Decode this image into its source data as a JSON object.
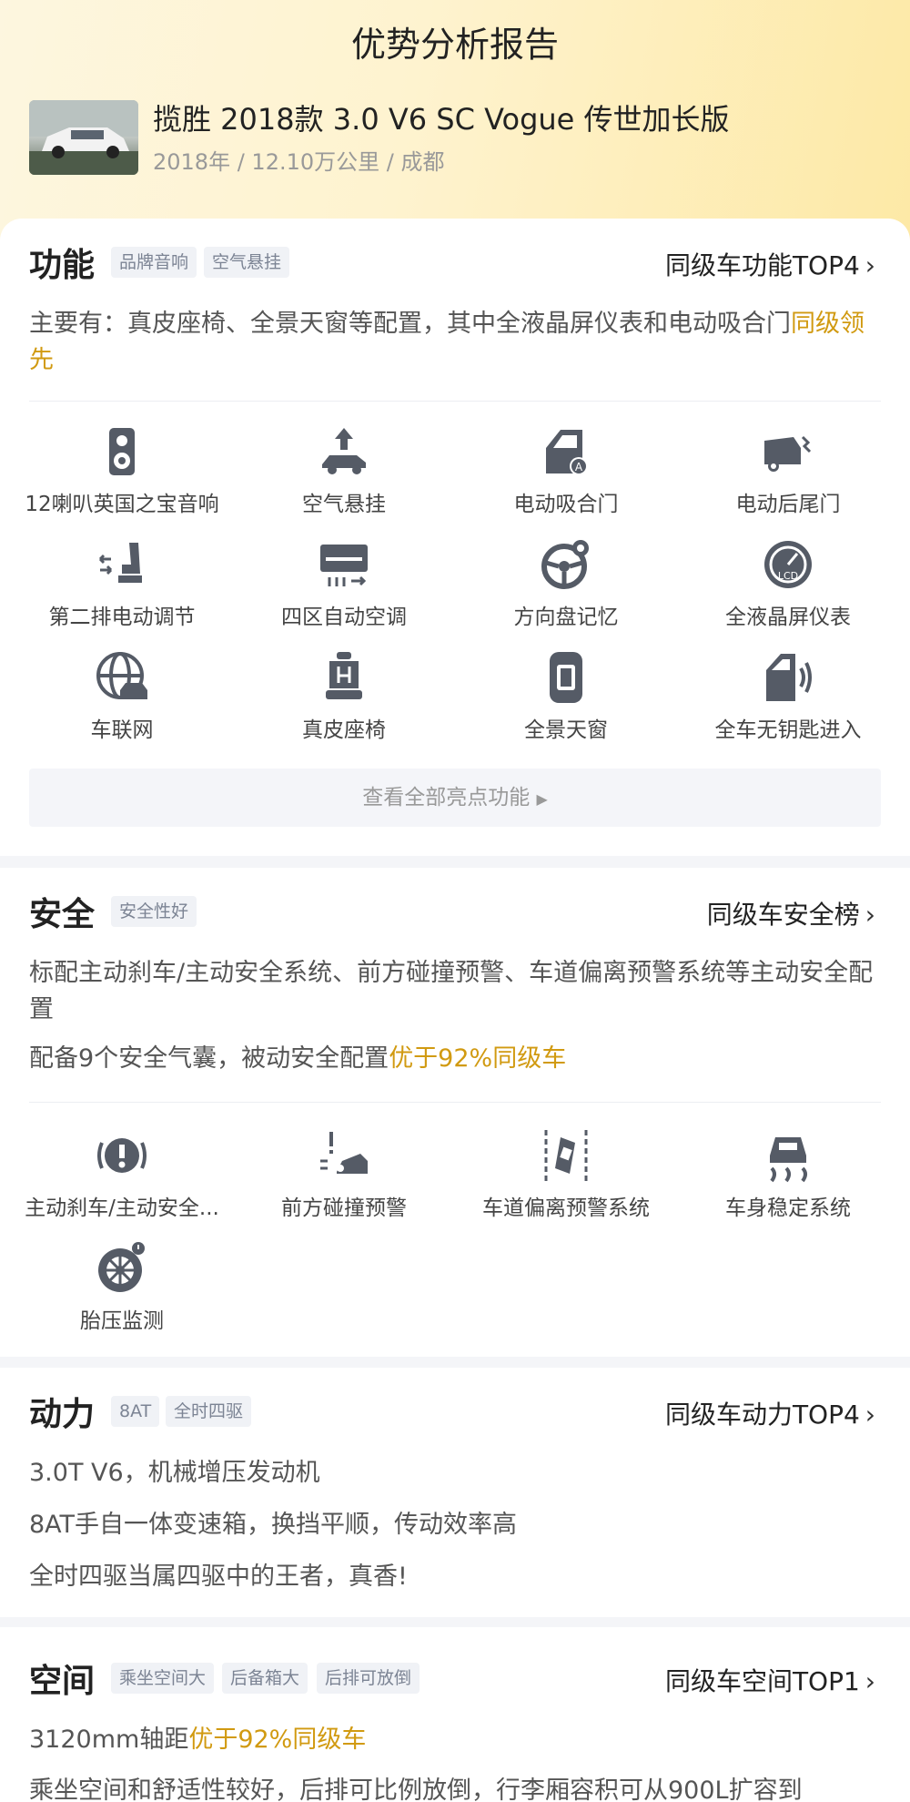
{
  "header": {
    "title": "优势分析报告",
    "car_name": "揽胜 2018款 3.0 V6 SC Vogue 传世加长版",
    "car_meta": "2018年 / 12.10万公里 / 成都"
  },
  "function": {
    "title": "功能",
    "tags": [
      "品牌音响",
      "空气悬挂"
    ],
    "rank_label": "同级车功能TOP4",
    "desc_main": "主要有：真皮座椅、全景天窗等配置，其中全液晶屏仪表和电动吸合门",
    "desc_hl": "同级领先",
    "features": [
      {
        "label": "12喇叭英国之宝音响",
        "icon": "speaker-icon"
      },
      {
        "label": "空气悬挂",
        "icon": "air-suspension-icon"
      },
      {
        "label": "电动吸合门",
        "icon": "soft-close-door-icon"
      },
      {
        "label": "电动后尾门",
        "icon": "power-tailgate-icon"
      },
      {
        "label": "第二排电动调节",
        "icon": "second-row-seat-icon"
      },
      {
        "label": "四区自动空调",
        "icon": "climate-control-icon"
      },
      {
        "label": "方向盘记忆",
        "icon": "steering-memory-icon"
      },
      {
        "label": "全液晶屏仪表",
        "icon": "lcd-gauge-icon"
      },
      {
        "label": "车联网",
        "icon": "connected-car-icon"
      },
      {
        "label": "真皮座椅",
        "icon": "leather-seat-icon"
      },
      {
        "label": "全景天窗",
        "icon": "panoramic-roof-icon"
      },
      {
        "label": "全车无钥匙进入",
        "icon": "keyless-entry-icon"
      }
    ],
    "view_all": "查看全部亮点功能"
  },
  "safety": {
    "title": "安全",
    "tags": [
      "安全性好"
    ],
    "rank_label": "同级车安全榜",
    "desc1": "标配主动刹车/主动安全系统、前方碰撞预警、车道偏离预警系统等主动安全配置",
    "desc2_main": "配备9个安全气囊，被动安全配置",
    "desc2_hl": "优于92%同级车",
    "features": [
      {
        "label": "主动刹车/主动安全...",
        "icon": "active-brake-icon"
      },
      {
        "label": "前方碰撞预警",
        "icon": "collision-warning-icon"
      },
      {
        "label": "车道偏离预警系统",
        "icon": "lane-departure-icon"
      },
      {
        "label": "车身稳定系统",
        "icon": "stability-control-icon"
      },
      {
        "label": "胎压监测",
        "icon": "tire-pressure-icon"
      }
    ]
  },
  "power": {
    "title": "动力",
    "tags": [
      "8AT",
      "全时四驱"
    ],
    "rank_label": "同级车动力TOP4",
    "lines": [
      "3.0T V6，机械增压发动机",
      "8AT手自一体变速箱，换挡平顺，传动效率高",
      "全时四驱当属四驱中的王者，真香!"
    ]
  },
  "space": {
    "title": "空间",
    "tags": [
      "乘坐空间大",
      "后备箱大",
      "后排可放倒"
    ],
    "rank_label": "同级车空间TOP1",
    "line1_main": "3120mm轴距",
    "line1_hl": "优于92%同级车",
    "line2": "乘坐空间和舒适性较好，后排可比例放倒，行李厢容积可从900L扩容到"
  },
  "colors": {
    "highlight": "#d19a11",
    "icon": "#555b66"
  }
}
